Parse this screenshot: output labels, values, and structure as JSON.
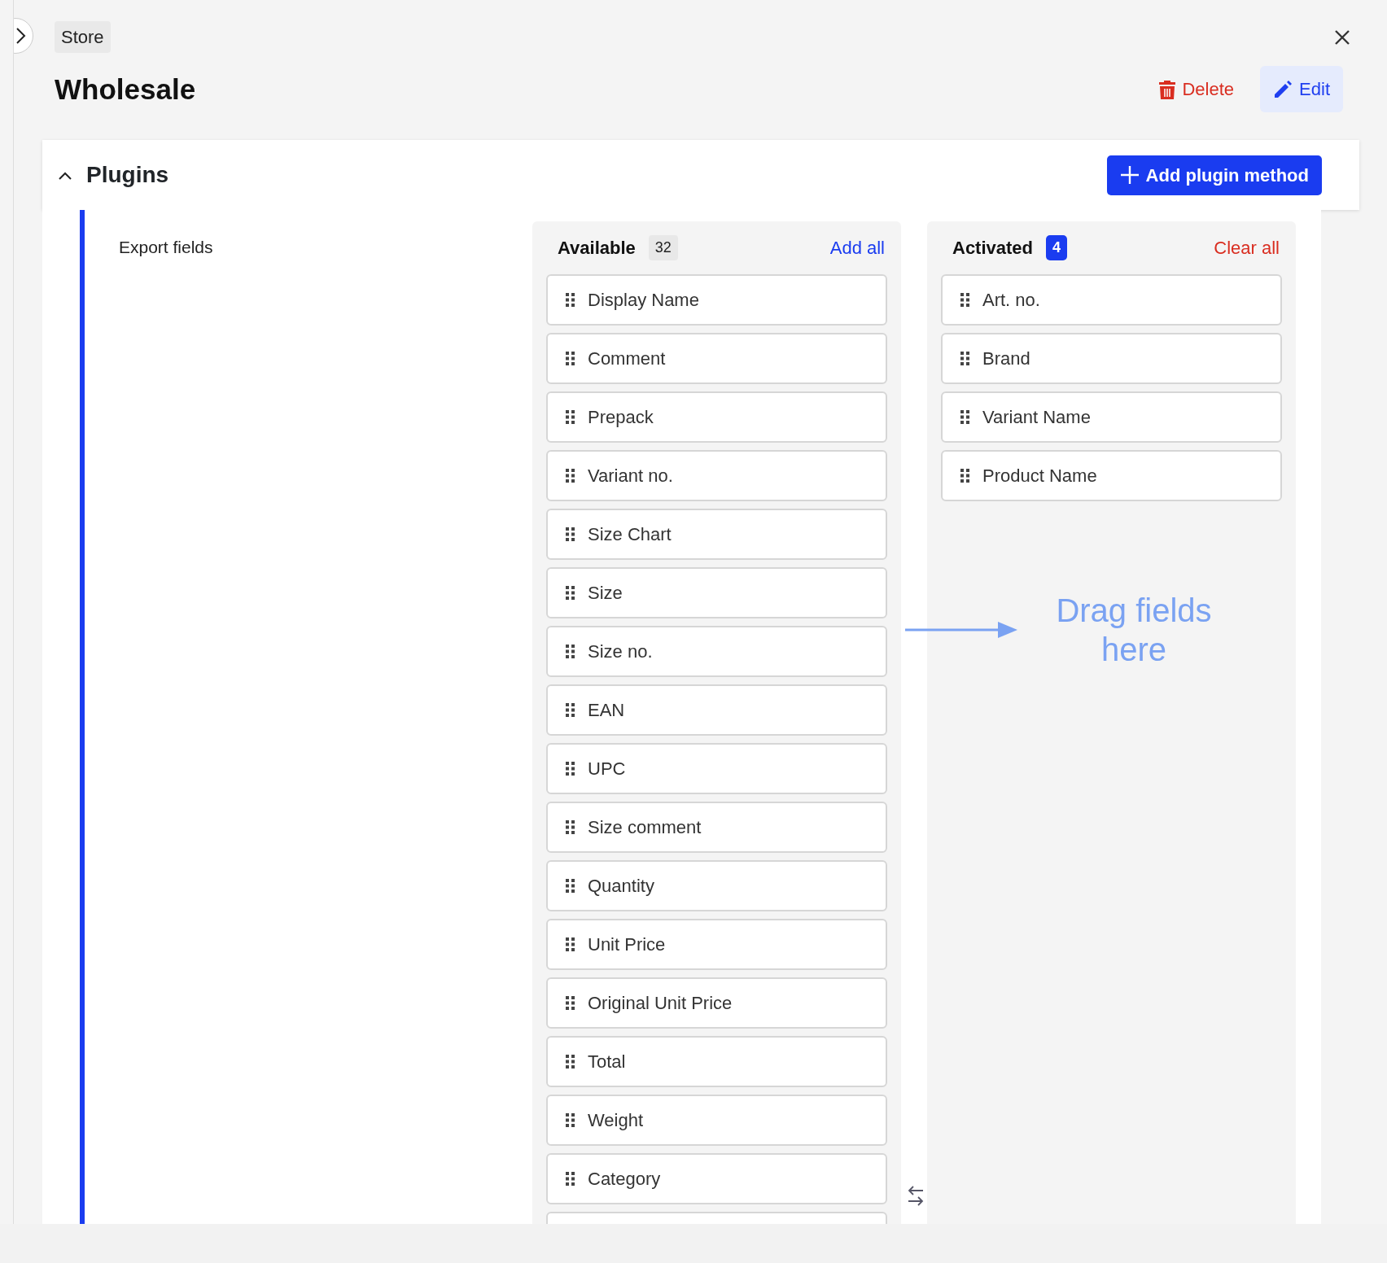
{
  "breadcrumb": "Store",
  "title": "Wholesale",
  "actions": [
    {
      "label": "Delete",
      "kind": "danger"
    },
    {
      "label": "Edit",
      "kind": "primary"
    }
  ],
  "section": {
    "title": "Plugins",
    "expanded": true,
    "add_button": "Add plugin method",
    "field_label": "Export fields",
    "available": {
      "title": "Available",
      "count": "32",
      "action": "Add all",
      "items": [
        "Display Name",
        "Comment",
        "Prepack",
        "Variant no.",
        "Size Chart",
        "Size",
        "Size no.",
        "EAN",
        "UPC",
        "Size comment",
        "Quantity",
        "Unit Price",
        "Original Unit Price",
        "Total",
        "Weight",
        "Category"
      ]
    },
    "activated": {
      "title": "Activated",
      "count": "4",
      "action": "Clear all",
      "items": [
        "Art. no.",
        "Brand",
        "Variant Name",
        "Product Name"
      ]
    },
    "drop_hint": "Drag fields here"
  }
}
